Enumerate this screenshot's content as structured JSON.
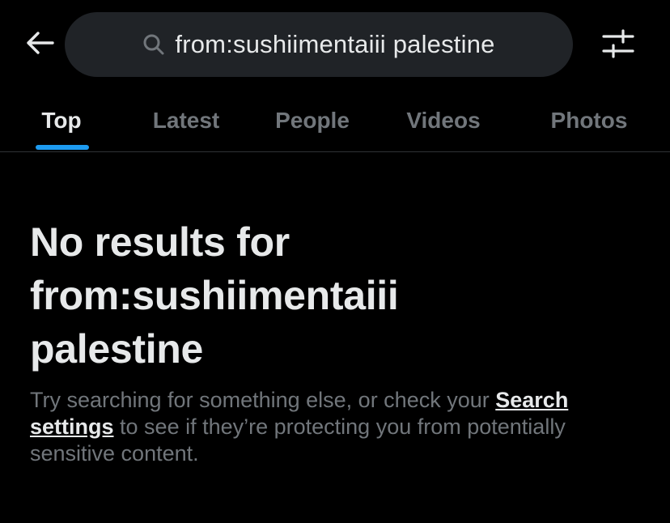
{
  "search": {
    "query": "from:sushiimentaiii palestine"
  },
  "icons": {
    "back": "arrow-left-icon",
    "search": "search-icon",
    "filter": "sliders-icon"
  },
  "tabs": [
    {
      "label": "Top",
      "active": true
    },
    {
      "label": "Latest",
      "active": false
    },
    {
      "label": "People",
      "active": false
    },
    {
      "label": "Videos",
      "active": false
    },
    {
      "label": "Photos",
      "active": false
    }
  ],
  "empty_state": {
    "title_line1": "No results for",
    "title_line2": "from:sushiimentaiii",
    "title_line3": "palestine",
    "body_before": "Try searching for something else, or check your ",
    "link": "Search settings",
    "body_after": " to see if they’re protecting you from potentially sensitive content."
  },
  "colors": {
    "background": "#000000",
    "accent": "#1d9bf0",
    "text_primary": "#e7e9ea",
    "text_secondary": "#71767b",
    "search_bg": "#202327"
  }
}
